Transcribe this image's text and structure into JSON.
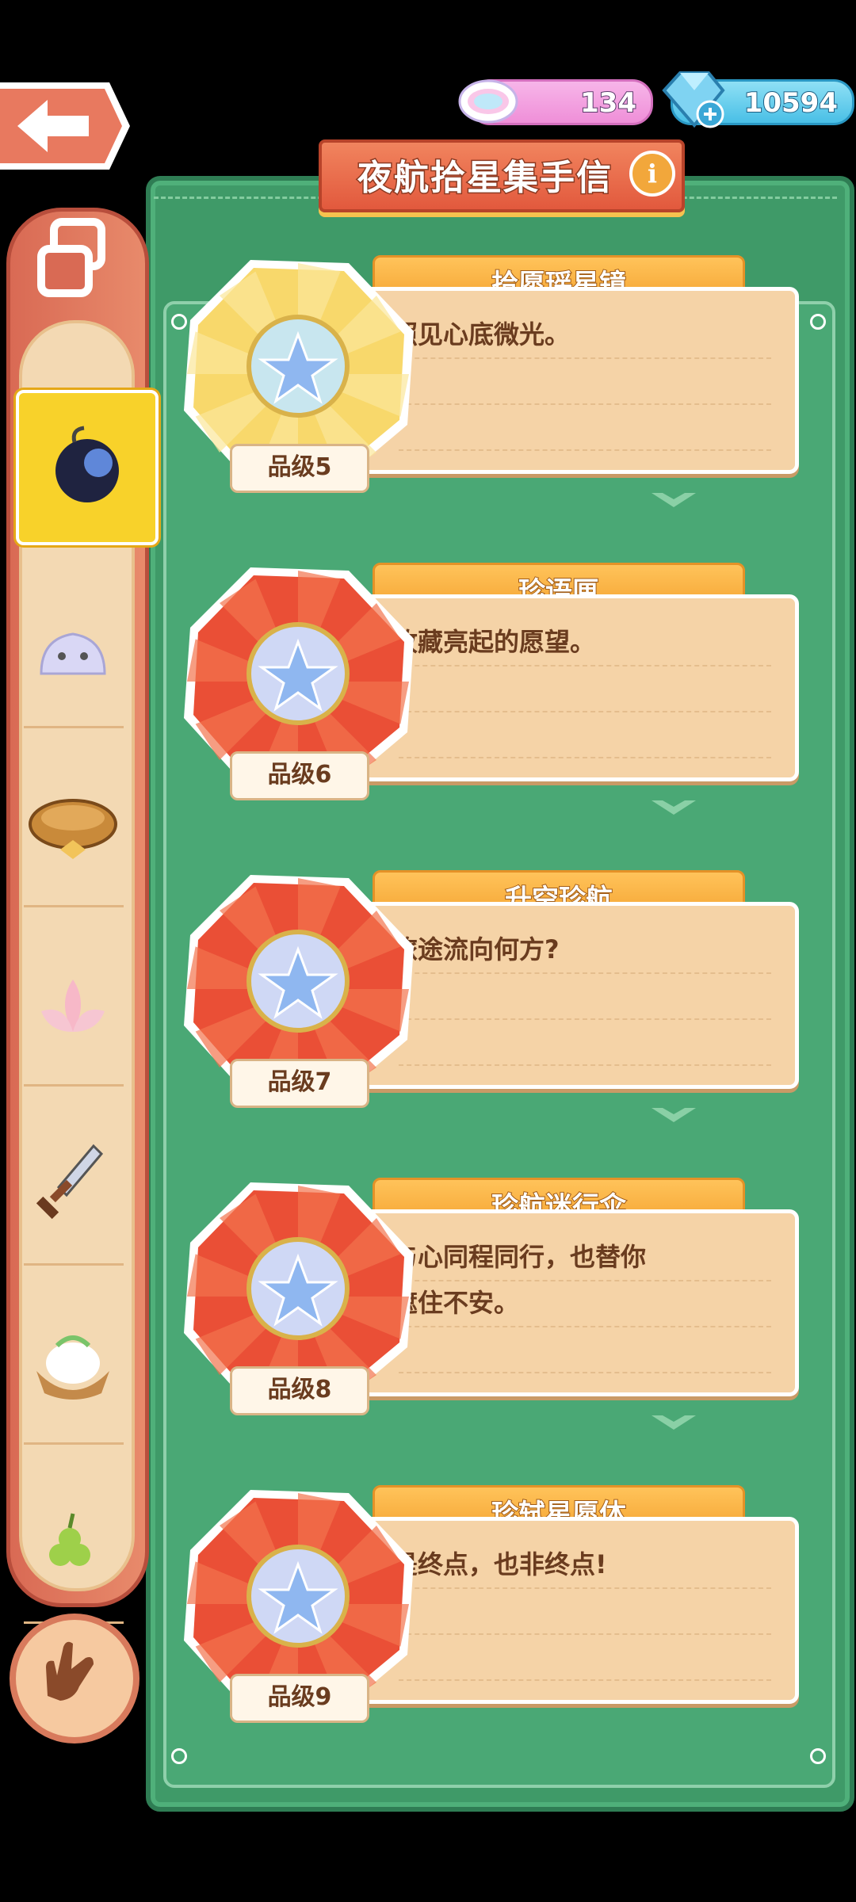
{
  "header": {
    "back_label": "",
    "rainbow_amount": "134",
    "gem_amount": "10594"
  },
  "panel": {
    "title": "夜航拾星集手信"
  },
  "items": [
    {
      "name": "拾愿瑶星镜",
      "desc_lines": [
        "照见心底微光。"
      ],
      "grade": "品级5"
    },
    {
      "name": "珍语匣",
      "desc_lines": [
        "收藏亮起的愿望。"
      ],
      "grade": "品级6"
    },
    {
      "name": "升空珍航",
      "desc_lines": [
        "旅途流向何方?"
      ],
      "grade": "品级7"
    },
    {
      "name": "珍航迷行伞",
      "desc_lines": [
        "与心同程同行，也替你",
        "遮住不安。"
      ],
      "grade": "品级8"
    },
    {
      "name": "珍轼星愿体",
      "desc_lines": [
        "是终点，也非终点!"
      ],
      "grade": "品级9"
    }
  ],
  "sidebar": {
    "items": [
      "bomb-icon",
      "slime-icon",
      "cushion-icon",
      "lotus-icon",
      "dagger-icon",
      "bun-icon",
      "grape-icon"
    ]
  },
  "colors": {
    "board_green": "#3f9a68",
    "card_peach": "#f5d3a7",
    "ribbon_red": "#e2593d",
    "tab_orange": "#f5a533"
  }
}
